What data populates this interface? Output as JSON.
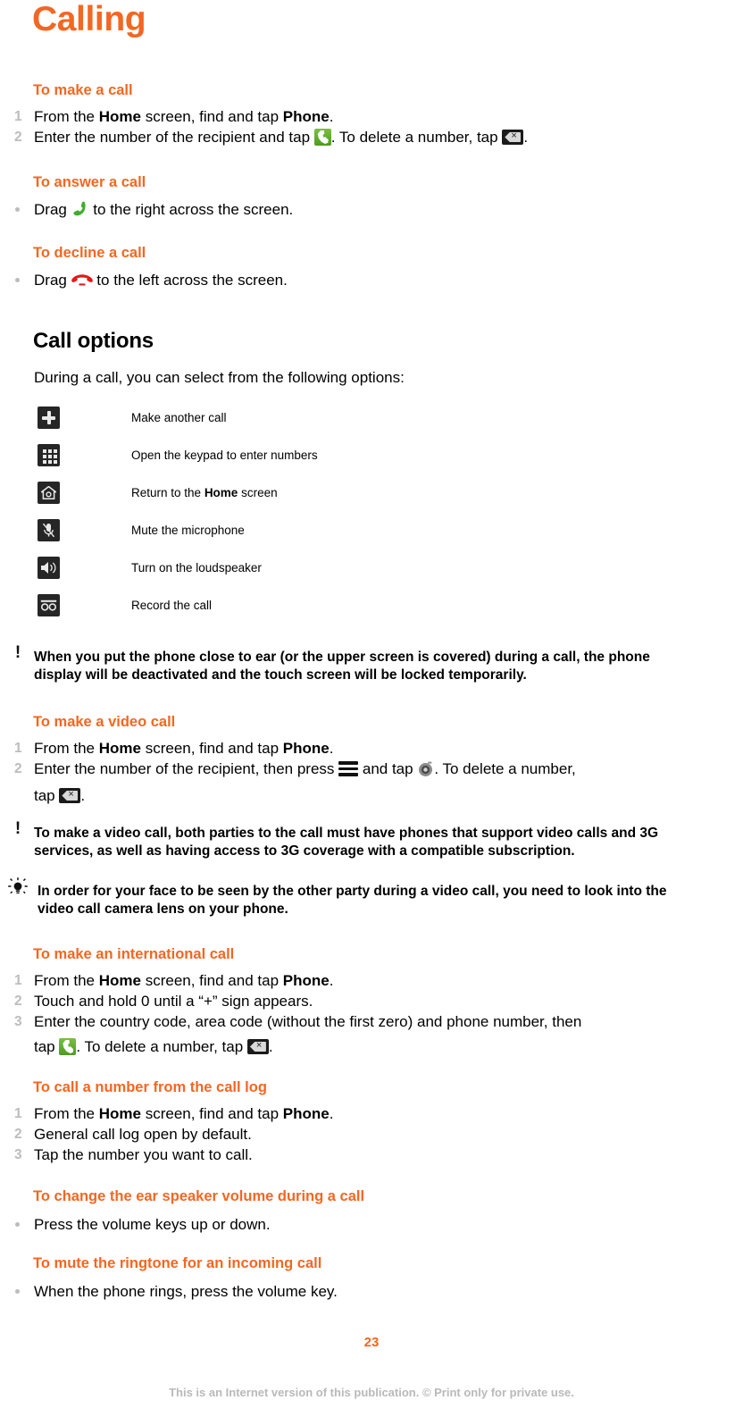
{
  "document": {
    "chapter_title": "Calling",
    "page_number": "23",
    "footer_note": "This is an Internet version of this publication. © Print only for private use.",
    "accent_color": "#F26722",
    "marker_color": "#BCBCBC"
  },
  "sections": {
    "make_a_call": {
      "heading": "To make a call",
      "steps": [
        {
          "num": "1",
          "pre": "From the ",
          "bold1": "Home",
          "mid": " screen, find and tap ",
          "bold2": "Phone",
          "post": "."
        },
        {
          "num": "2",
          "pre": "Enter the number of the recipient and tap ",
          "mid": ". To delete a number, tap ",
          "post": "."
        }
      ]
    },
    "answer_a_call": {
      "heading": "To answer a call",
      "bullet_pre": "Drag ",
      "bullet_post": " to the right across the screen."
    },
    "decline_a_call": {
      "heading": "To decline a call",
      "bullet_pre": "Drag ",
      "bullet_post": " to the left across the screen."
    },
    "call_options": {
      "heading": "Call options",
      "intro": "During a call, you can select from the following options:",
      "rows": [
        {
          "icon": "add-call-icon",
          "label": "Make another call"
        },
        {
          "icon": "keypad-icon",
          "label": "Open the keypad to enter numbers"
        },
        {
          "icon": "home-icon",
          "label_pre": "Return to the ",
          "label_bold": "Home",
          "label_post": " screen"
        },
        {
          "icon": "mute-microphone-icon",
          "label": "Mute the microphone"
        },
        {
          "icon": "loudspeaker-icon",
          "label": "Turn on the loudspeaker"
        },
        {
          "icon": "record-call-icon",
          "label": "Record the call"
        }
      ]
    },
    "proximity_note": {
      "icon": "exclamation-note-icon",
      "line1": "When you put the phone close to ear (or the upper screen is covered) during a call, the phone",
      "line2": "display will be deactivated and the touch screen will be locked temporarily."
    },
    "make_a_video_call": {
      "heading": "To make a video call",
      "steps": [
        {
          "num": "1",
          "pre": "From the ",
          "bold1": "Home",
          "mid": " screen, find and tap ",
          "bold2": "Phone",
          "post": "."
        },
        {
          "num": "2",
          "pre": "Enter the number of the recipient, then press ",
          "mid": " and tap ",
          "post": ". To delete a number,",
          "line2_pre": "tap ",
          "line2_post": "."
        }
      ]
    },
    "video_call_note": {
      "icon": "exclamation-note-icon",
      "line1": "To make a video call, both parties to the call must have phones that support video calls and 3G",
      "line2": "services, as well as having access to 3G coverage with a compatible subscription."
    },
    "video_call_tip": {
      "icon": "lightbulb-tip-icon",
      "line1": "In order for your face to be seen by the other party during a video call, you need to look into the",
      "line2": "video call camera lens on your phone."
    },
    "international_call": {
      "heading": "To make an international call",
      "steps": [
        {
          "num": "1",
          "pre": "From the ",
          "bold1": "Home",
          "mid": " screen, find and tap ",
          "bold2": "Phone",
          "post": "."
        },
        {
          "num": "2",
          "text": "Touch and hold 0 until a “+” sign appears."
        },
        {
          "num": "3",
          "text": "Enter the country code, area code (without the first zero) and phone number, then",
          "line2_pre": "tap ",
          "line2_mid": ". To delete a number, tap ",
          "line2_post": "."
        }
      ]
    },
    "call_log": {
      "heading": "To call a number from the call log",
      "steps": [
        {
          "num": "1",
          "pre": "From the ",
          "bold1": "Home",
          "mid": " screen, find and tap ",
          "bold2": "Phone",
          "post": "."
        },
        {
          "num": "2",
          "text": "General call log open by default."
        },
        {
          "num": "3",
          "text": "Tap the number you want to call."
        }
      ]
    },
    "ear_speaker_volume": {
      "heading": "To change the ear speaker volume during a call",
      "bullet": "Press the volume keys up or down."
    },
    "mute_ringtone": {
      "heading": "To mute the ringtone for an incoming call",
      "bullet": "When the phone rings, press the volume key."
    }
  }
}
